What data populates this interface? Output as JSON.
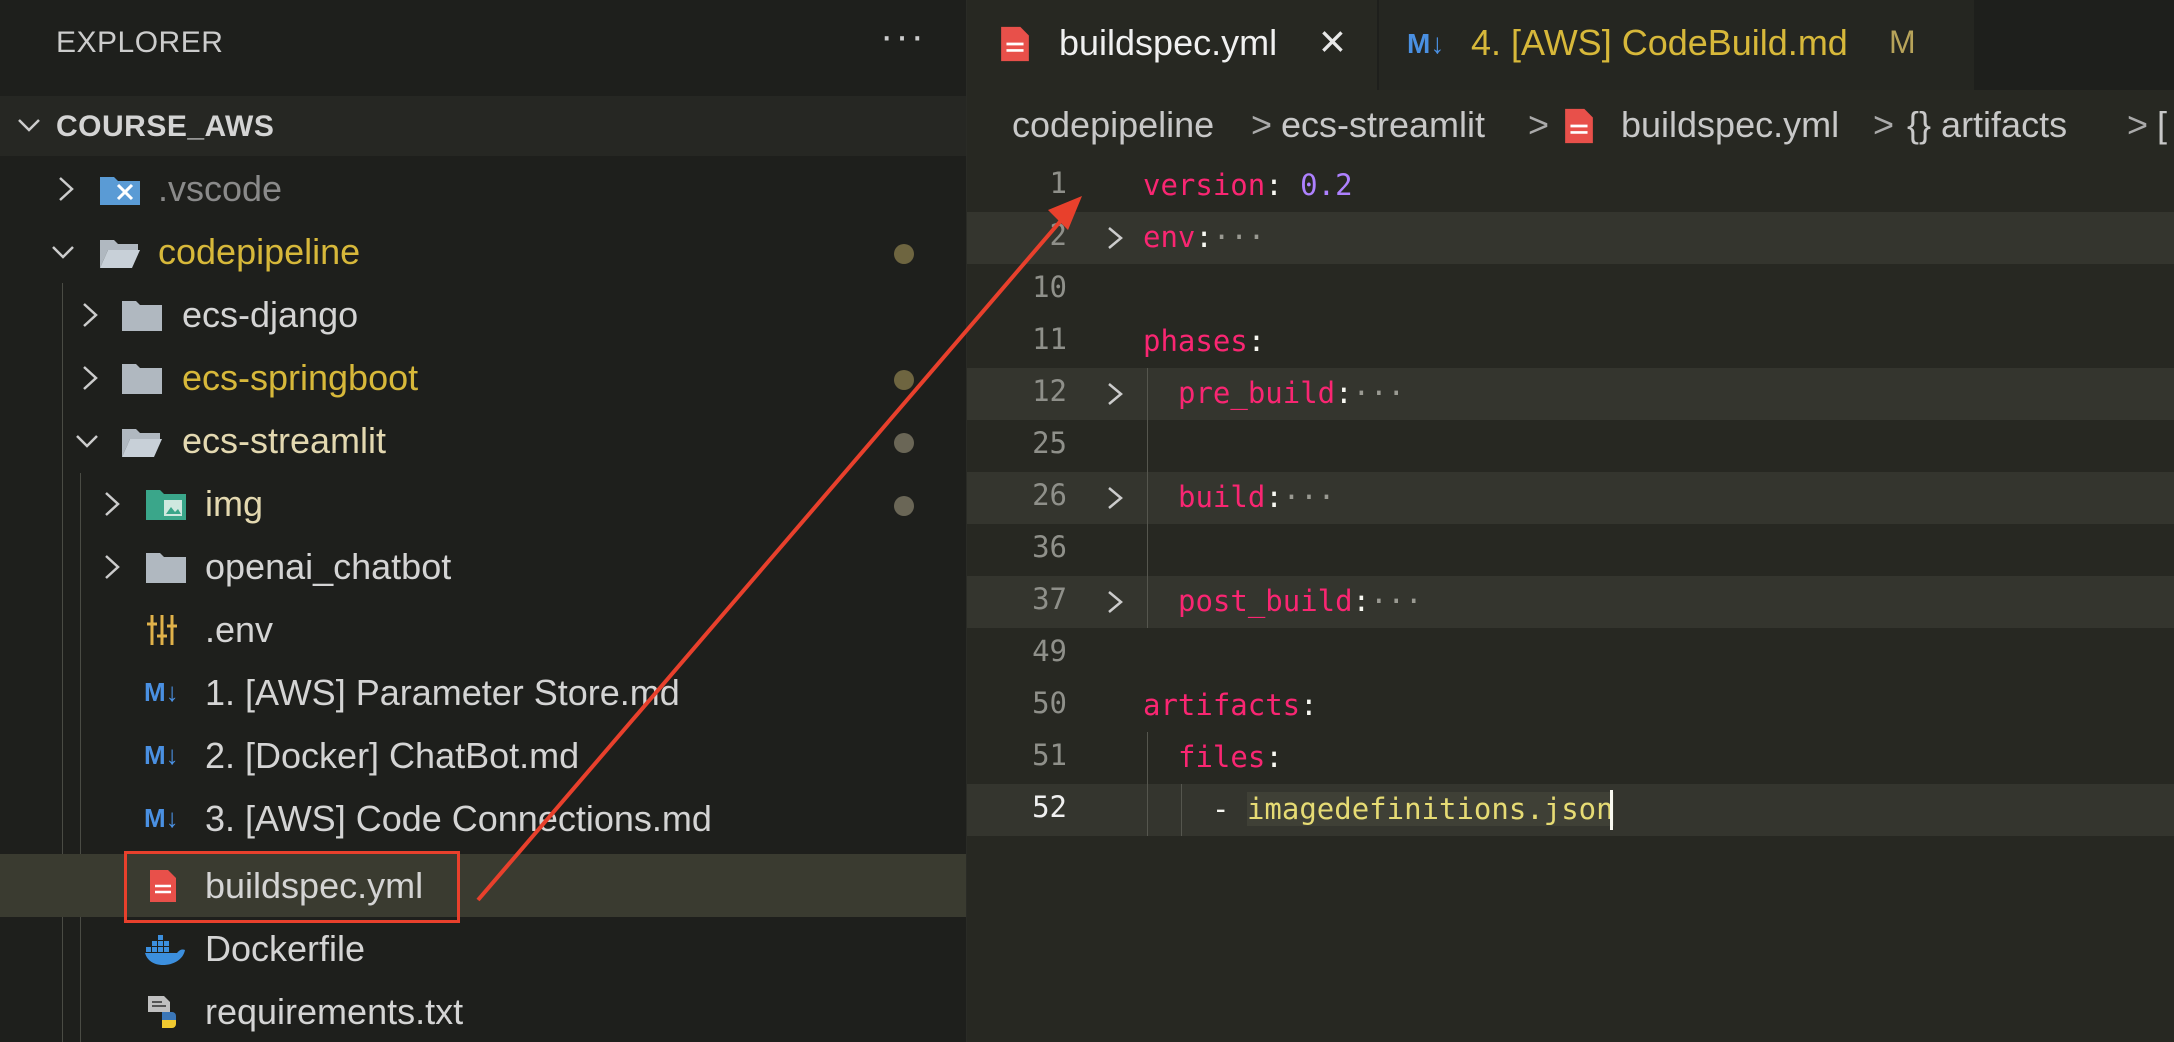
{
  "sidebar": {
    "title": "EXPLORER",
    "more_label": "···",
    "section": "COURSE_AWS",
    "items": [
      {
        "label": "vscode_dot",
        "text": ".vscode"
      },
      {
        "text": "codepipeline"
      },
      {
        "text": "ecs-django"
      },
      {
        "text": "ecs-springboot"
      },
      {
        "text": "ecs-streamlit"
      },
      {
        "text": "img"
      },
      {
        "text": "openai_chatbot"
      },
      {
        "text": ".env"
      },
      {
        "text": "1. [AWS] Parameter Store.md"
      },
      {
        "text": "2. [Docker] ChatBot.md"
      },
      {
        "text": "3. [AWS] Code Connections.md"
      },
      {
        "text": "buildspec.yml"
      },
      {
        "text": "Dockerfile"
      },
      {
        "text": "requirements.txt"
      }
    ]
  },
  "tabs": [
    {
      "label": "buildspec.yml",
      "close": "×",
      "active": true
    },
    {
      "label": "4. [AWS] CodeBuild.md",
      "badge": "M",
      "active": false
    }
  ],
  "breadcrumb": [
    "codepipeline",
    "ecs-streamlit",
    "buildspec.yml",
    "{} artifacts",
    "["
  ],
  "breadcrumb_seps": [
    ">",
    ">",
    ">",
    ">"
  ],
  "code": {
    "line_numbers": [
      "1",
      "2",
      "10",
      "11",
      "12",
      "25",
      "26",
      "36",
      "37",
      "49",
      "50",
      "51",
      "52"
    ],
    "version_key": "version",
    "version_val": "0.2",
    "env_key": "env",
    "phases_key": "phases",
    "pre_build_key": "pre_build",
    "build_key": "build",
    "post_build_key": "post_build",
    "artifacts_key": "artifacts",
    "files_key": "files",
    "dash": "-",
    "files_value": "imagedefinitions.json",
    "colon": ":",
    "ellipsis": "···"
  },
  "colors": {
    "accent_annotation": "#e8402c",
    "modified_dot": "#6e6540",
    "folder_modified_text": "#d7b83a",
    "yaml_key": "#f92672",
    "yaml_number": "#ae81ff",
    "yaml_string": "#e6db74"
  }
}
